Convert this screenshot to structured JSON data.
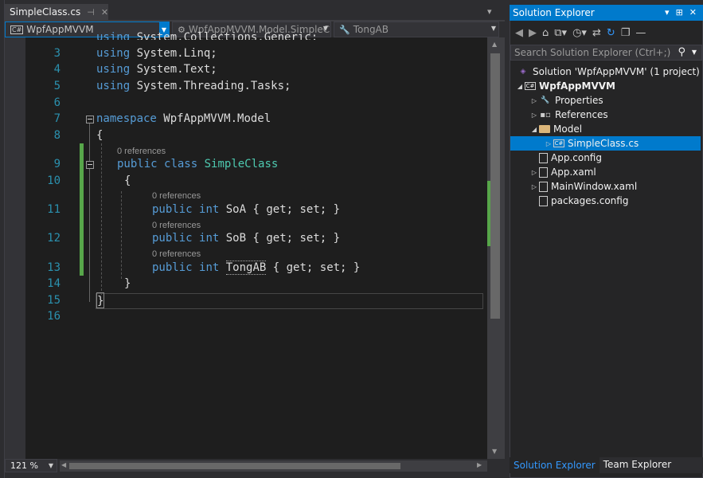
{
  "doc_tab": {
    "title": "SimpleClass.cs",
    "pin": "⊣",
    "close": "✕"
  },
  "tab_row_right": "▾",
  "navbar": {
    "project": "WpfAppMVVM",
    "project_icon": "C#",
    "class": "WpfAppMVVM.Model.SimpleCla",
    "member": "TongAB"
  },
  "editor": {
    "lines": [
      {
        "num": "",
        "code": "using System.Collections.Generic;"
      },
      {
        "num": "3"
      },
      {
        "num": "4"
      },
      {
        "num": "5"
      },
      {
        "num": "6"
      },
      {
        "num": "7"
      },
      {
        "num": "8"
      },
      {
        "num": "9"
      },
      {
        "num": "10"
      },
      {
        "num": "11"
      },
      {
        "num": "12"
      },
      {
        "num": "13"
      },
      {
        "num": "14"
      },
      {
        "num": "15"
      },
      {
        "num": "16"
      }
    ],
    "tokens": {
      "using": "using",
      "ns2": "System.Linq;",
      "ns3": "System.Text;",
      "ns4": "System.Threading.Tasks;",
      "ns1": "System.Collections.Generic;",
      "namespace_kw": "namespace",
      "namespace_name": "WpfAppMVVM.Model",
      "brace_open": "{",
      "brace_close": "}",
      "public": "public",
      "class": "class",
      "class_name": "SimpleClass",
      "int": "int",
      "prop_a": "SoA",
      "prop_b": "SoB",
      "prop_c": "TongAB",
      "accessors": "{ get; set; }",
      "ref_label": "0 references"
    }
  },
  "zoom": {
    "value": "121 %"
  },
  "solution_explorer": {
    "title": "Solution Explorer",
    "header_buttons": [
      "▾",
      "⊞",
      "✕"
    ],
    "search_placeholder": "Search Solution Explorer (Ctrl+;)",
    "tree": [
      {
        "label": "Solution 'WpfAppMVVM' (1 project)",
        "icon": "solution-icon"
      },
      {
        "label": "WpfAppMVVM",
        "icon": "csharp-project-icon",
        "bold": true
      },
      {
        "label": "Properties",
        "icon": "wrench-icon"
      },
      {
        "label": "References",
        "icon": "references-icon"
      },
      {
        "label": "Model",
        "icon": "folder-icon"
      },
      {
        "label": "SimpleClass.cs",
        "icon": "csharp-file-icon",
        "selected": true
      },
      {
        "label": "App.config",
        "icon": "config-file-icon"
      },
      {
        "label": "App.xaml",
        "icon": "xaml-file-icon"
      },
      {
        "label": "MainWindow.xaml",
        "icon": "xaml-file-icon"
      },
      {
        "label": "packages.config",
        "icon": "config-file-icon"
      }
    ],
    "bottom_tabs": [
      "Solution Explorer",
      "Team Explorer"
    ]
  },
  "colors": {
    "accent": "#007acc",
    "keyword": "#569cd6",
    "type": "#4ec9b0",
    "line_number": "#2b91af",
    "change_bar": "#57a64a"
  }
}
